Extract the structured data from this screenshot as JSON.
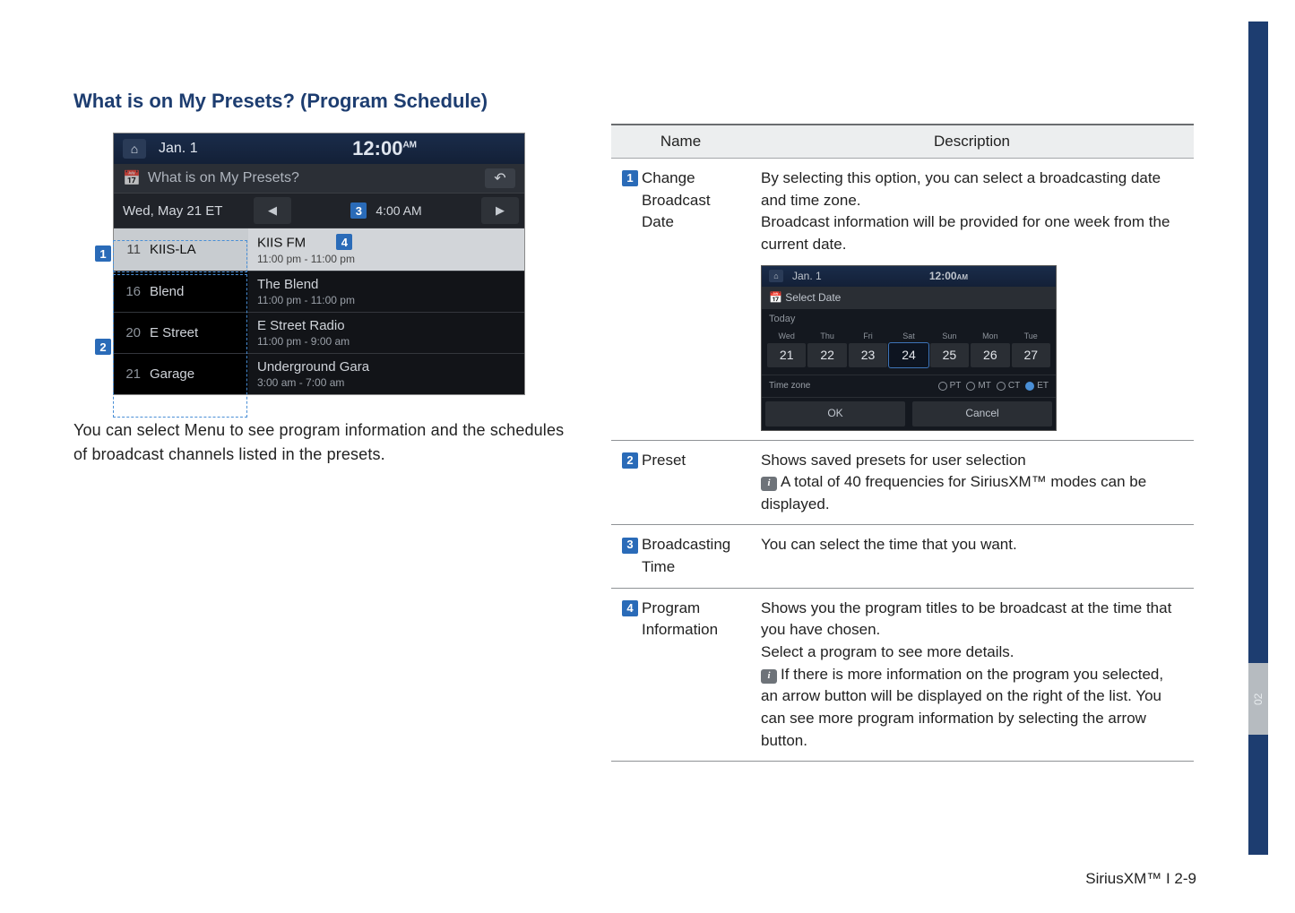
{
  "section_title": "What is on My Presets? (Program Schedule)",
  "caption": "You can select Menu to see program information and the sched­ules of broadcast channels listed in the presets.",
  "device": {
    "date_small": "Jan.  1",
    "clock": "12:00",
    "ampm": "AM",
    "screen_title": "What is on My Presets?",
    "date_cell": "Wed, May 21 ET",
    "time_cell": "4:00 AM",
    "rows": [
      {
        "num": "11",
        "name": "KIIS-LA",
        "prog": "KIIS FM",
        "time": "11:00 pm - 11:00 pm"
      },
      {
        "num": "16",
        "name": "Blend",
        "prog": "The Blend",
        "time": "11:00 pm - 11:00 pm"
      },
      {
        "num": "20",
        "name": "E Street",
        "prog": "E Street Radio",
        "time": "11:00 pm - 9:00 am"
      },
      {
        "num": "21",
        "name": "Garage",
        "prog": "Underground Gara",
        "time": "3:00 am - 7:00 am"
      }
    ]
  },
  "table": {
    "header_name": "Name",
    "header_desc": "Description",
    "rows": [
      {
        "n": "1",
        "name_l1": "Change",
        "name_l2": "Broadcast",
        "name_l3": "Date",
        "desc_p1": "By selecting this option, you can select a broad­casting date and time zone.",
        "desc_p2": "Broadcast information will be provided for one week from the current date."
      },
      {
        "n": "2",
        "name_l1": "Preset",
        "desc_p1": "Shows saved presets for user selection",
        "info": "A total of 40 frequencies for SiriusXM™ modes can be displayed."
      },
      {
        "n": "3",
        "name_l1": "Broadcasting",
        "name_l2": "Time",
        "desc_p1": "You can select the time that you want."
      },
      {
        "n": "4",
        "name_l1": "Program",
        "name_l2": "Information",
        "desc_p1": "Shows you the program titles to be broadcast at the time that you have chosen.",
        "desc_p2": "Select a program to see more details.",
        "info": "If there is more information on the program you selected, an arrow button will be displayed on the right of the list. You can see more program information by selecting the arrow button."
      }
    ]
  },
  "mini": {
    "date_small": "Jan.  1",
    "clock": "12:00",
    "ampm": "AM",
    "title": "Select Date",
    "today": "Today",
    "days": [
      {
        "dw": "Wed",
        "dn": "21"
      },
      {
        "dw": "Thu",
        "dn": "22"
      },
      {
        "dw": "Fri",
        "dn": "23"
      },
      {
        "dw": "Sat",
        "dn": "24"
      },
      {
        "dw": "Sun",
        "dn": "25"
      },
      {
        "dw": "Mon",
        "dn": "26"
      },
      {
        "dw": "Tue",
        "dn": "27"
      }
    ],
    "tz_label": "Time zone",
    "tz_opts": [
      "PT",
      "MT",
      "CT",
      "ET"
    ],
    "tz_selected": "ET",
    "ok": "OK",
    "cancel": "Cancel"
  },
  "footer": "SiriusXM™ I 2-9",
  "sidetab": "02"
}
